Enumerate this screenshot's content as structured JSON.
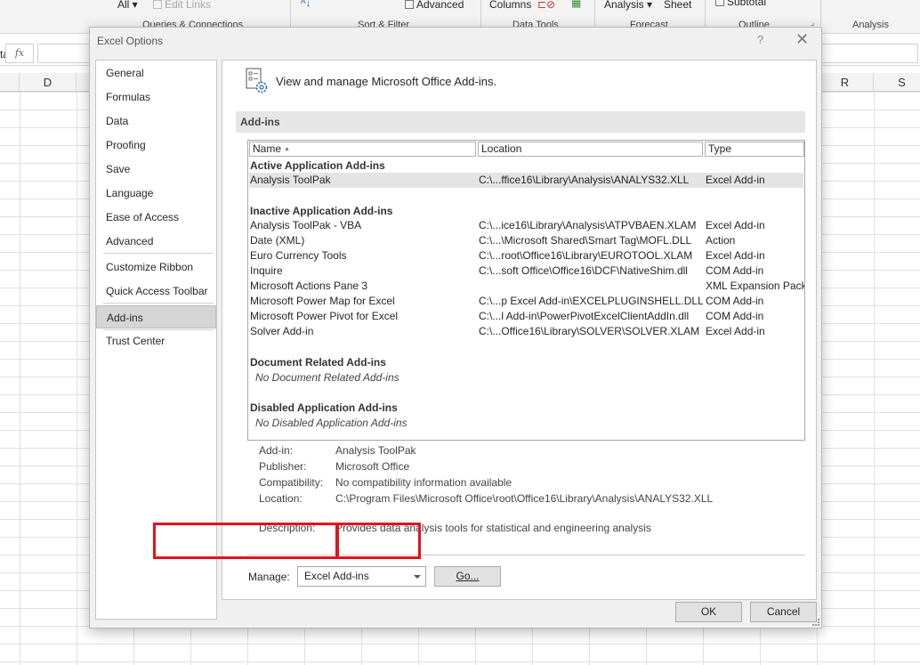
{
  "ribbon": {
    "all_label": "All",
    "edit_links": "Edit Links",
    "advanced": "Advanced",
    "columns": "Columns",
    "analysis_btn": "Analysis",
    "sheet": "Sheet",
    "subtotal": "Subtotal",
    "groups": {
      "queries": "Queries & Connections",
      "sort_filter": "Sort & Filter",
      "data_tools": "Data Tools",
      "forecast": "Forecast",
      "outline": "Outline",
      "analysis": "Analysis"
    }
  },
  "formula_bar": {
    "name_fragment": "ta",
    "fx": "fx"
  },
  "columns": {
    "d": "D",
    "r": "R",
    "s": "S"
  },
  "dialog": {
    "title": "Excel Options",
    "help": "?",
    "close": "✕",
    "nav": [
      "General",
      "Formulas",
      "Data",
      "Proofing",
      "Save",
      "Language",
      "Ease of Access",
      "Advanced",
      "Customize Ribbon",
      "Quick Access Toolbar",
      "Add-ins",
      "Trust Center"
    ],
    "selected_nav": "Add-ins",
    "heading": "View and manage Microsoft Office Add-ins.",
    "section": "Add-ins",
    "table": {
      "headers": {
        "name": "Name",
        "location": "Location",
        "type": "Type"
      },
      "active_group": "Active Application Add-ins",
      "active": [
        {
          "name": "Analysis ToolPak",
          "location": "C:\\...ffice16\\Library\\Analysis\\ANALYS32.XLL",
          "type": "Excel Add-in"
        }
      ],
      "inactive_group": "Inactive Application Add-ins",
      "inactive": [
        {
          "name": "Analysis ToolPak - VBA",
          "location": "C:\\...ice16\\Library\\Analysis\\ATPVBAEN.XLAM",
          "type": "Excel Add-in"
        },
        {
          "name": "Date (XML)",
          "location": "C:\\...\\Microsoft Shared\\Smart Tag\\MOFL.DLL",
          "type": "Action"
        },
        {
          "name": "Euro Currency Tools",
          "location": "C:\\...root\\Office16\\Library\\EUROTOOL.XLAM",
          "type": "Excel Add-in"
        },
        {
          "name": "Inquire",
          "location": "C:\\...soft Office\\Office16\\DCF\\NativeShim.dll",
          "type": "COM Add-in"
        },
        {
          "name": "Microsoft Actions Pane 3",
          "location": "",
          "type": "XML Expansion Pack"
        },
        {
          "name": "Microsoft Power Map for Excel",
          "location": "C:\\...p Excel Add-in\\EXCELPLUGINSHELL.DLL",
          "type": "COM Add-in"
        },
        {
          "name": "Microsoft Power Pivot for Excel",
          "location": "C:\\...l Add-in\\PowerPivotExcelClientAddIn.dll",
          "type": "COM Add-in"
        },
        {
          "name": "Solver Add-in",
          "location": "C:\\...Office16\\Library\\SOLVER\\SOLVER.XLAM",
          "type": "Excel Add-in"
        }
      ],
      "document_group": "Document Related Add-ins",
      "document_none": "No Document Related Add-ins",
      "disabled_group": "Disabled Application Add-ins",
      "disabled_none": "No Disabled Application Add-ins"
    },
    "details": {
      "addin_label": "Add-in:",
      "addin_value": "Analysis ToolPak",
      "publisher_label": "Publisher:",
      "publisher_value": "Microsoft Office",
      "compat_label": "Compatibility:",
      "compat_value": "No compatibility information available",
      "location_label": "Location:",
      "location_value": "C:\\Program Files\\Microsoft Office\\root\\Office16\\Library\\Analysis\\ANALYS32.XLL",
      "description_label": "Description:",
      "description_value": "Provides data analysis tools for statistical and engineering analysis"
    },
    "manage": {
      "label": "Manage:",
      "value": "Excel Add-ins",
      "go": "Go..."
    },
    "ok": "OK",
    "cancel": "Cancel",
    "highlight_color": "#e0141e"
  }
}
